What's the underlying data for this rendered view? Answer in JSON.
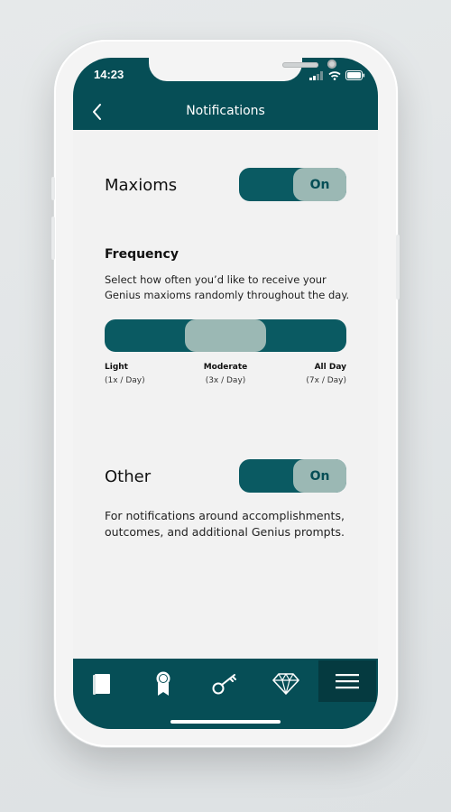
{
  "status_bar": {
    "time": "14:23"
  },
  "header": {
    "title": "Notifications"
  },
  "maxioms": {
    "label": "Maxioms",
    "toggle": "On"
  },
  "frequency": {
    "title": "Frequency",
    "description": "Select how often you’d like to receive your Genius maxioms randomly throughout the day.",
    "selected_index": 1,
    "options": [
      {
        "name": "Light",
        "sub": "(1x / Day)"
      },
      {
        "name": "Moderate",
        "sub": "(3x / Day)"
      },
      {
        "name": "All Day",
        "sub": "(7x / Day)"
      }
    ]
  },
  "other": {
    "label": "Other",
    "toggle": "On",
    "description": "For notifications around accomplishments, outcomes, and additional Genius prompts."
  },
  "nav": {
    "items": [
      "book-icon",
      "award-ribbon-icon",
      "key-icon",
      "diamond-icon",
      "menu-icon"
    ],
    "active": "menu-icon"
  },
  "colors": {
    "primary": "#064e56",
    "toggle_track": "#0a5a62",
    "toggle_knob": "#9bb8b4",
    "background": "#f2f2f2"
  }
}
